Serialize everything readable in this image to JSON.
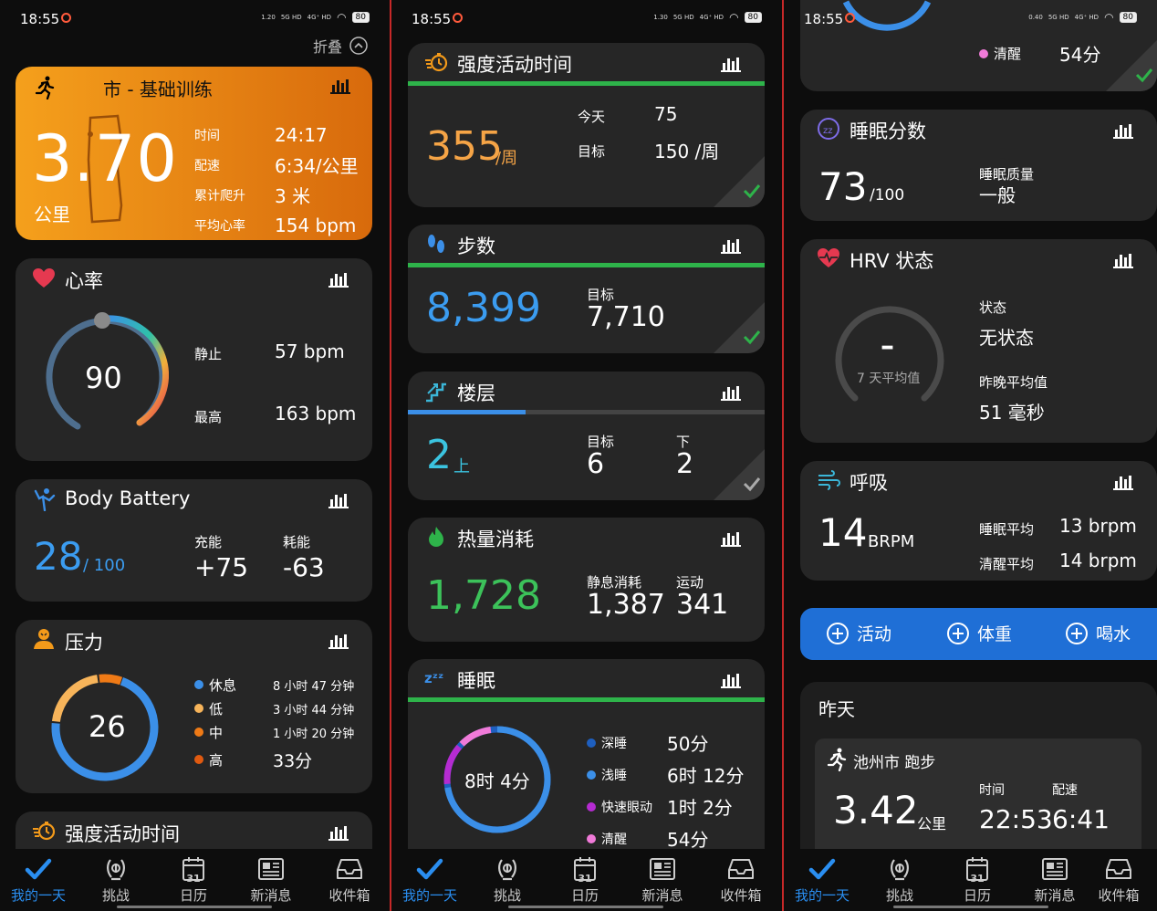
{
  "status": {
    "time": "18:55",
    "speed": [
      "1.20",
      "1.30",
      "0.40"
    ],
    "speed_unit": "KB/s",
    "net": "5G HD",
    "net2": "4G⁺ HD",
    "battery": "80"
  },
  "colors": {
    "accent": "#2a8ef0",
    "orange": "#f39a1a",
    "green": "#2eb34a",
    "blue_ring": "#3b8fe8",
    "ring_grey": "#444"
  },
  "p1": {
    "fold_label": "折叠",
    "activity": {
      "title": "市 - 基础训练",
      "distance": "3.70",
      "unit": "公里",
      "rows": [
        {
          "label": "时间",
          "value": "24:17"
        },
        {
          "label": "配速",
          "value": "6:34/公里"
        },
        {
          "label": "累计爬升",
          "value": "3 米"
        },
        {
          "label": "平均心率",
          "value": "154 bpm"
        }
      ]
    },
    "heart": {
      "title": "心率",
      "value": "90",
      "rest_label": "静止",
      "rest": "57 bpm",
      "max_label": "最高",
      "max": "163 bpm"
    },
    "battery": {
      "title": "Body Battery",
      "value": "28",
      "unit": "/ 100",
      "charge_label": "充能",
      "charge": "+75",
      "drain_label": "耗能",
      "drain": "-63"
    },
    "stress": {
      "title": "压力",
      "value": "26",
      "legend": [
        {
          "label": "休息",
          "value": "8 小时 47 分钟",
          "color": "#3b8fe8"
        },
        {
          "label": "低",
          "value": "3 小时 44 分钟",
          "color": "#f7b45a"
        },
        {
          "label": "中",
          "value": "1 小时 20 分钟",
          "color": "#ef7a16"
        },
        {
          "label": "高",
          "value": "33分",
          "color": "#e05a10"
        }
      ]
    },
    "intensity_title": "强度活动时间"
  },
  "p2": {
    "intensity": {
      "title": "强度活动时间",
      "value": "355",
      "unit": "/周",
      "today_label": "今天",
      "today": "75",
      "goal_label": "目标",
      "goal": "150 /周"
    },
    "steps": {
      "title": "步数",
      "value": "8,399",
      "goal_label": "目标",
      "goal": "7,710"
    },
    "floors": {
      "title": "楼层",
      "value": "2",
      "unit": "上",
      "goal_label": "目标",
      "goal": "6",
      "down_label": "下",
      "down": "2",
      "progress": 0.33
    },
    "calories": {
      "title": "热量消耗",
      "value": "1,728",
      "rest_label": "静息消耗",
      "rest": "1,387",
      "active_label": "运动",
      "active": "341"
    },
    "sleep": {
      "title": "睡眠",
      "value": "8时 4分",
      "legend": [
        {
          "label": "深睡",
          "value": "50分",
          "color": "#1e5fbf"
        },
        {
          "label": "浅睡",
          "value": "6时 12分",
          "color": "#3b8fe8"
        },
        {
          "label": "快速眼动",
          "value": "1时 2分",
          "color": "#b52bd1"
        },
        {
          "label": "清醒",
          "value": "54分",
          "color": "#f07ad8"
        }
      ]
    }
  },
  "p3": {
    "awake_label": "清醒",
    "awake_value": "54分",
    "sleep_score": {
      "title": "睡眠分数",
      "value": "73",
      "unit": "/100",
      "quality_label": "睡眠质量",
      "quality": "一般"
    },
    "hrv": {
      "title": "HRV 状态",
      "center": "–",
      "center_sub": "7 天平均值",
      "status_label": "状态",
      "status": "无状态",
      "avg_label": "昨晚平均值",
      "avg": "51 毫秒"
    },
    "resp": {
      "title": "呼吸",
      "value": "14",
      "unit": "BRPM",
      "sleep_label": "睡眠平均",
      "sleep": "13 brpm",
      "awake_label": "清醒平均",
      "awake": "14 brpm"
    },
    "actions": [
      "活动",
      "体重",
      "喝水"
    ],
    "yesterday": {
      "title": "昨天",
      "activity": "池州市 跑步",
      "distance": "3.42",
      "unit": "公里",
      "time_label": "时间",
      "time": "22:53",
      "pace_label": "配速",
      "pace": "6:41"
    }
  },
  "nav": [
    "我的一天",
    "挑战",
    "日历",
    "新消息",
    "收件箱"
  ],
  "calendar_day": "31"
}
